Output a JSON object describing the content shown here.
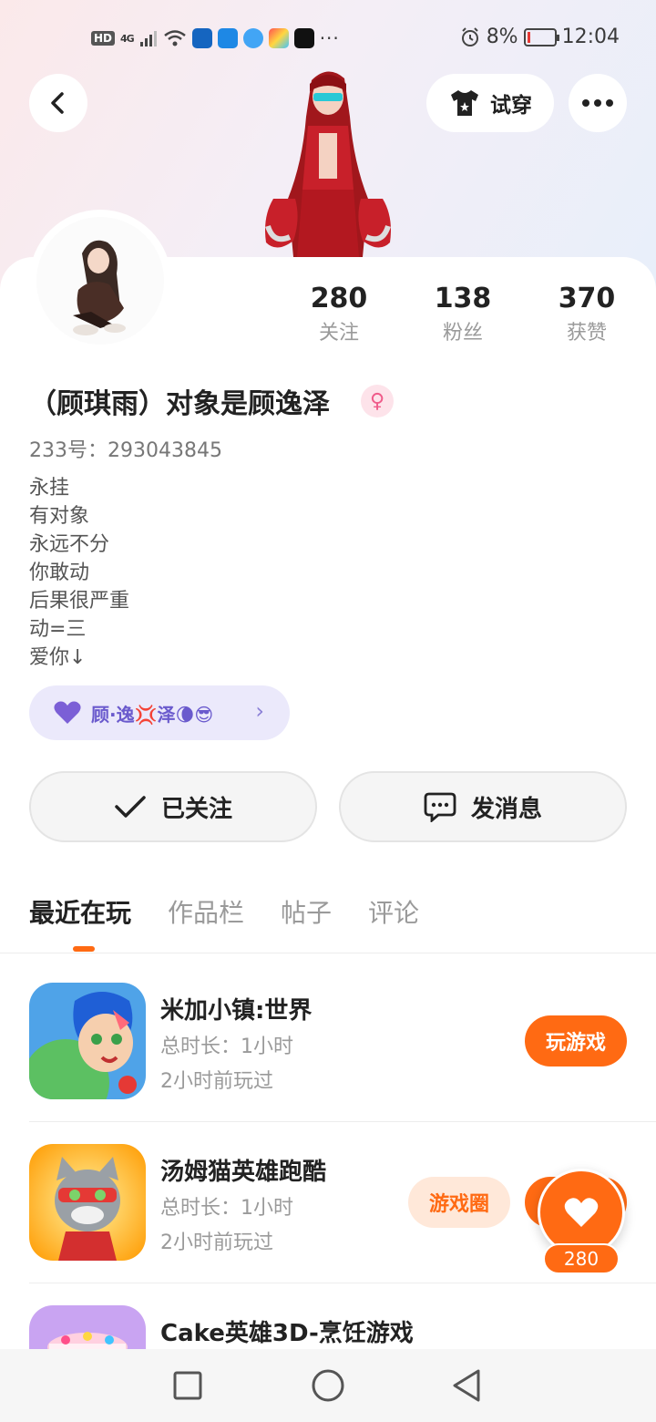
{
  "status_bar": {
    "hd": "HD",
    "network": "4G",
    "time": "12:04",
    "battery_percent_text": "8%",
    "battery_level": 0.08,
    "more": "···"
  },
  "header": {
    "tryon_label": "试穿"
  },
  "stats": [
    {
      "value": "280",
      "label": "关注"
    },
    {
      "value": "138",
      "label": "粉丝"
    },
    {
      "value": "370",
      "label": "获赞"
    }
  ],
  "profile": {
    "nickname": "（顾琪雨）对象是顾逸泽",
    "gender_symbol": "♀",
    "uid": "233号：293043845",
    "bio": [
      "永挂",
      "有对象",
      "永远不分",
      "你敢动",
      "后果很严重",
      "动=三",
      "爱你↓"
    ],
    "tag_text": "顾·逸💢泽🌘😎"
  },
  "actions": {
    "follow_label": "已关注",
    "message_label": "发消息"
  },
  "tabs": [
    "最近在玩",
    "作品栏",
    "帖子",
    "评论"
  ],
  "games": [
    {
      "title": "米加小镇:世界",
      "duration": "总时长：1小时",
      "last_played": "2小时前玩过",
      "primary": "玩游戏",
      "secondary": ""
    },
    {
      "title": "汤姆猫英雄跑酷",
      "duration": "总时长：1小时",
      "last_played": "2小时前玩过",
      "primary": "玩游戏",
      "secondary": "游戏圈"
    },
    {
      "title": "Cake英雄3D-烹饪游戏",
      "duration": "",
      "last_played": "",
      "primary": "",
      "secondary": ""
    }
  ],
  "like": {
    "count": "280"
  },
  "colors": {
    "accent": "#ff6a13",
    "tag_bg": "#ebe9fb",
    "tag_text": "#6a5acd"
  }
}
